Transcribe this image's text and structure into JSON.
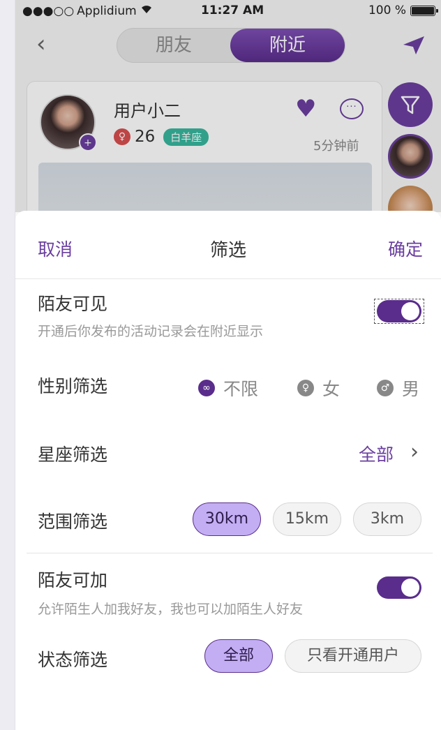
{
  "status": {
    "carrier": "Applidium",
    "time": "11:27 AM",
    "battery": "100 %"
  },
  "nav": {
    "tab_friends": "朋友",
    "tab_nearby": "附近"
  },
  "card": {
    "username": "用户小二",
    "age": "26",
    "zodiac": "白羊座",
    "time_ago": "5分钟前"
  },
  "sheet": {
    "cancel": "取消",
    "title": "筛选",
    "confirm": "确定",
    "visible": {
      "label": "陌友可见",
      "desc": "开通后你发布的活动记录会在附近显示",
      "on": true
    },
    "gender": {
      "label": "性别筛选",
      "options": [
        "不限",
        "女",
        "男"
      ],
      "selected": "不限"
    },
    "zodiac": {
      "label": "星座筛选",
      "value": "全部"
    },
    "range": {
      "label": "范围筛选",
      "options": [
        "30km",
        "15km",
        "3km"
      ],
      "selected": "30km"
    },
    "addable": {
      "label": "陌友可加",
      "desc": "允许陌生人加我好友，我也可以加陌生人好友",
      "on": true
    },
    "state": {
      "label": "状态筛选",
      "options": [
        "全部",
        "只看开通用户"
      ],
      "selected": "全部"
    }
  },
  "colors": {
    "accent": "#6b3fa0",
    "pill_selected": "#c3aef4",
    "zodiac_badge": "#38b79f",
    "female": "#d94f4f"
  }
}
